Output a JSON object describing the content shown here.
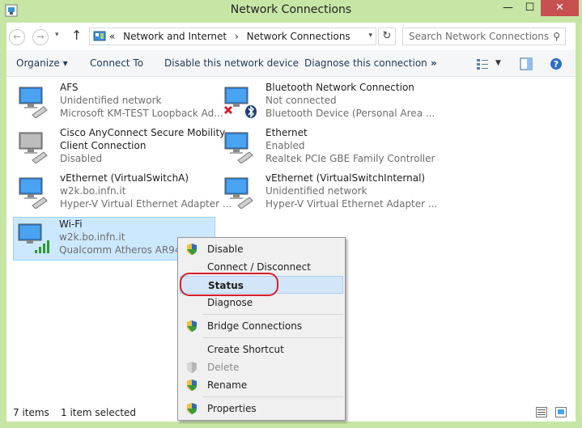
{
  "window": {
    "title": "Network Connections",
    "buttons": {
      "minimize": "—",
      "maximize": "☐",
      "close": "✕"
    }
  },
  "address": {
    "crumbs": [
      "«",
      "Network and Internet",
      "›",
      "Network Connections"
    ],
    "search_placeholder": "Search Network Connections"
  },
  "toolbar": {
    "organize": "Organize ▾",
    "connect": "Connect To",
    "disable": "Disable this network device",
    "diagnose": "Diagnose this connection",
    "more": "»"
  },
  "items": [
    {
      "name": "AFS",
      "status": "Unidentified network",
      "device": "Microsoft KM-TEST Loopback Ad...",
      "icon": "network-adapter-icon"
    },
    {
      "name": "Bluetooth Network Connection",
      "status": "Not connected",
      "device": "Bluetooth Device (Personal Area ...",
      "icon": "bluetooth-adapter-icon"
    },
    {
      "name": "Cisco AnyConnect Secure Mobility",
      "name2": "Client Connection",
      "status": "Disabled",
      "icon": "network-adapter-disabled-icon"
    },
    {
      "name": "Ethernet",
      "status": "Enabled",
      "device": "Realtek PCIe GBE Family Controller",
      "icon": "network-adapter-icon"
    },
    {
      "name": "vEthernet (VirtualSwitchA)",
      "status": "w2k.bo.infn.it",
      "device": "Hyper-V Virtual Ethernet Adapter ...",
      "icon": "network-adapter-icon"
    },
    {
      "name": "vEthernet (VirtualSwitchInternal)",
      "status": "Unidentified network",
      "device": "Hyper-V Virtual Ethernet Adapter ...",
      "icon": "network-adapter-icon"
    },
    {
      "name": "Wi-Fi",
      "status": "w2k.bo.infn.it",
      "device": "Qualcomm Atheros AR946x",
      "icon": "wifi-adapter-icon"
    }
  ],
  "context_menu": {
    "items": [
      {
        "label": "Disable",
        "shield": true
      },
      {
        "label": "Connect / Disconnect",
        "shield": false
      },
      {
        "label": "Status",
        "shield": false,
        "bold": true,
        "highlighted": true
      },
      {
        "label": "Diagnose",
        "shield": false
      },
      {
        "label": "Bridge Connections",
        "shield": true
      },
      {
        "label": "Create Shortcut",
        "shield": false
      },
      {
        "label": "Delete",
        "shield": true,
        "disabled": true
      },
      {
        "label": "Rename",
        "shield": true
      },
      {
        "label": "Properties",
        "shield": true
      }
    ]
  },
  "statusbar": {
    "count": "7 items",
    "selected": "1 item selected"
  },
  "colors": {
    "titlebar": "#c7e6a6",
    "selection": "#cce8ff",
    "highlight_ring": "#d81e2c",
    "close": "#c75050"
  }
}
